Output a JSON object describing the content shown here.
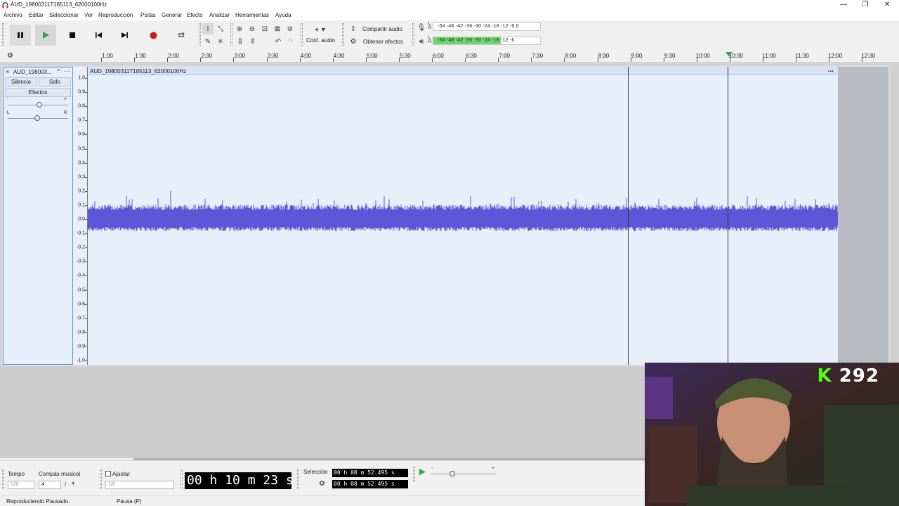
{
  "window": {
    "title": "AUD_19800311T185113_62000100Hz"
  },
  "menu": [
    "Archivo",
    "Editar",
    "Seleccionar",
    "Ver",
    "Reproducción",
    "Pistas",
    "Generar",
    "Efecto",
    "Analizar",
    "Herramientas",
    "Ayuda"
  ],
  "toolbar": {
    "audio_setup_label": "Conf. audio",
    "share_audio_label": "Compartir audio",
    "get_effects_label": "Obtener efectos",
    "meter_ticks": "-54  -48  -42  -36  -30  -24  -18  -12  -6   0",
    "meter_ticks_play": "-54  -48  -42  -36  -30  -24  -18  -12  -6",
    "meter_lr_top": "L R",
    "meter_lr_bottom": "L R"
  },
  "timeline": {
    "labels": [
      "1:00",
      "1:30",
      "2:00",
      "2:30",
      "3:00",
      "3:30",
      "4:00",
      "4:30",
      "5:00",
      "5:30",
      "6:00",
      "6:30",
      "7:00",
      "7:30",
      "8:00",
      "8:30",
      "9:00",
      "9:30",
      "10:00",
      "10:30",
      "11:00",
      "11:30",
      "12:00",
      "12:30"
    ]
  },
  "track": {
    "name": "AUD_198003...",
    "mute_label": "Silencio",
    "solo_label": "Solo",
    "effects_label": "Efectos",
    "gain_minus": "-",
    "gain_plus": "+",
    "pan_left": "L",
    "pan_right": "R",
    "clip_name": "AUD_19800311T185113_62000100Hz",
    "clip_menu": "...",
    "vruler": [
      "1.0",
      "0.9",
      "0.8",
      "0.7",
      "0.6",
      "0.5",
      "0.4",
      "0.3",
      "0.2",
      "0.1",
      "0.0",
      "-0.1",
      "-0.2",
      "-0.3",
      "-0.4",
      "-0.5",
      "-0.6",
      "-0.7",
      "-0.8",
      "-0.9",
      "-1.0"
    ]
  },
  "bottom": {
    "tempo_label": "Tempo",
    "tempo_value": "120",
    "time_signature_label": "Compás musical",
    "time_sig_num": "4",
    "time_sig_sep": "/",
    "time_sig_den": "4",
    "snap_label": "Ajustar",
    "snap_value": "1/8",
    "time_display": "00 h 10 m 23 s",
    "selection_label": "Selección",
    "selection_start": "00 h 08 m 52.495 s",
    "selection_end": "00 h 08 m 52.495 s",
    "play_speed_minus": "-",
    "play_speed_plus": "+"
  },
  "status": {
    "left": "Reproduciendo Pausado.",
    "right": "Pausa (P)"
  },
  "overlay": {
    "counter_prefix": "K",
    "counter_value": "292"
  },
  "colors": {
    "waveform": "#5b57d6",
    "record": "#d01818",
    "meter_green": "#6fd66f",
    "kick_green": "#53fc18"
  }
}
